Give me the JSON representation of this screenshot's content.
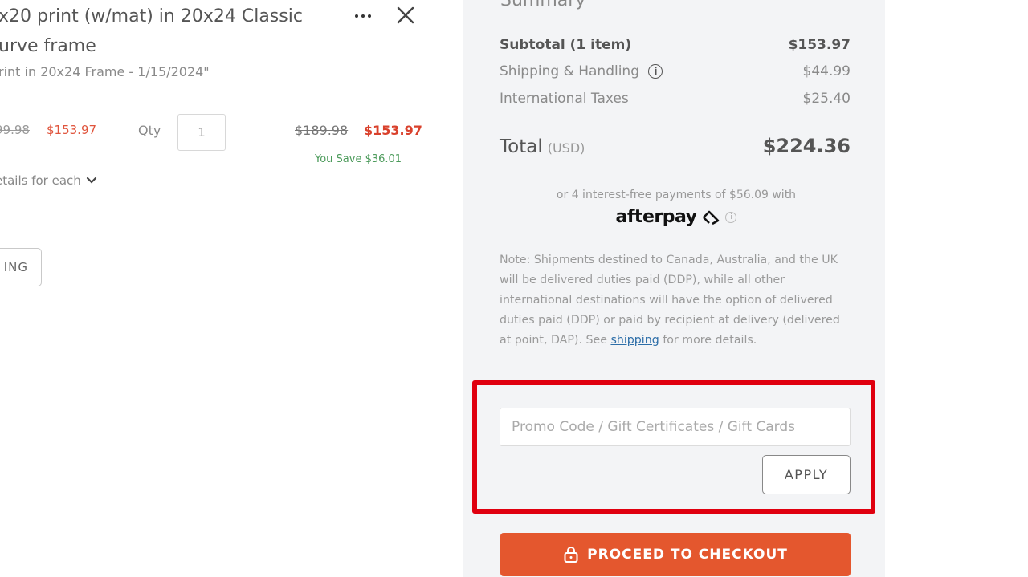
{
  "item": {
    "title": "x20 print (w/mat) in 20x24 Classic urve frame",
    "subtitle": "rint in 20x24 Frame - 1/15/2024\"",
    "original_price_left": "99.98",
    "sale_price_left": "$153.97",
    "qty_label": "Qty",
    "qty_value": "1",
    "original_price_right": "$189.98",
    "sale_price_right": "$153.97",
    "you_save": "You Save $36.01",
    "details_label": "etails for each",
    "partial_button_label": "ING"
  },
  "summary": {
    "title": "Summary",
    "subtotal_label": "Subtotal (1 item)",
    "subtotal_value": "$153.97",
    "shipping_label": "Shipping & Handling",
    "shipping_value": "$44.99",
    "taxes_label": "International Taxes",
    "taxes_value": "$25.40",
    "total_label": "Total",
    "total_currency": "(USD)",
    "total_value": "$224.36",
    "afterpay_text": "or 4 interest-free payments of $56.09 with",
    "afterpay_logo": "afterpay",
    "note_text": "Note: Shipments destined to Canada, Australia, and the UK will be delivered duties paid (DDP), while all other international destinations will have the option of delivered duties paid (DDP) or paid by recipient at delivery (delivered at point, DAP). See",
    "note_link": "shipping",
    "note_end": "for more details.",
    "promo_placeholder": "Promo Code / Gift Certificates / Gift Cards",
    "apply_label": "APPLY",
    "checkout_label": "PROCEED TO CHECKOUT"
  },
  "colors": {
    "checkout_button": "#e4572e",
    "sale_price": "#d9412c",
    "savings": "#4b9a5a",
    "promo_highlight": "#e0000f",
    "panel_background": "#f3f4f6"
  },
  "icons": [
    "more-icon",
    "close-icon",
    "chevron-down-icon",
    "info-icon",
    "lock-icon"
  ]
}
